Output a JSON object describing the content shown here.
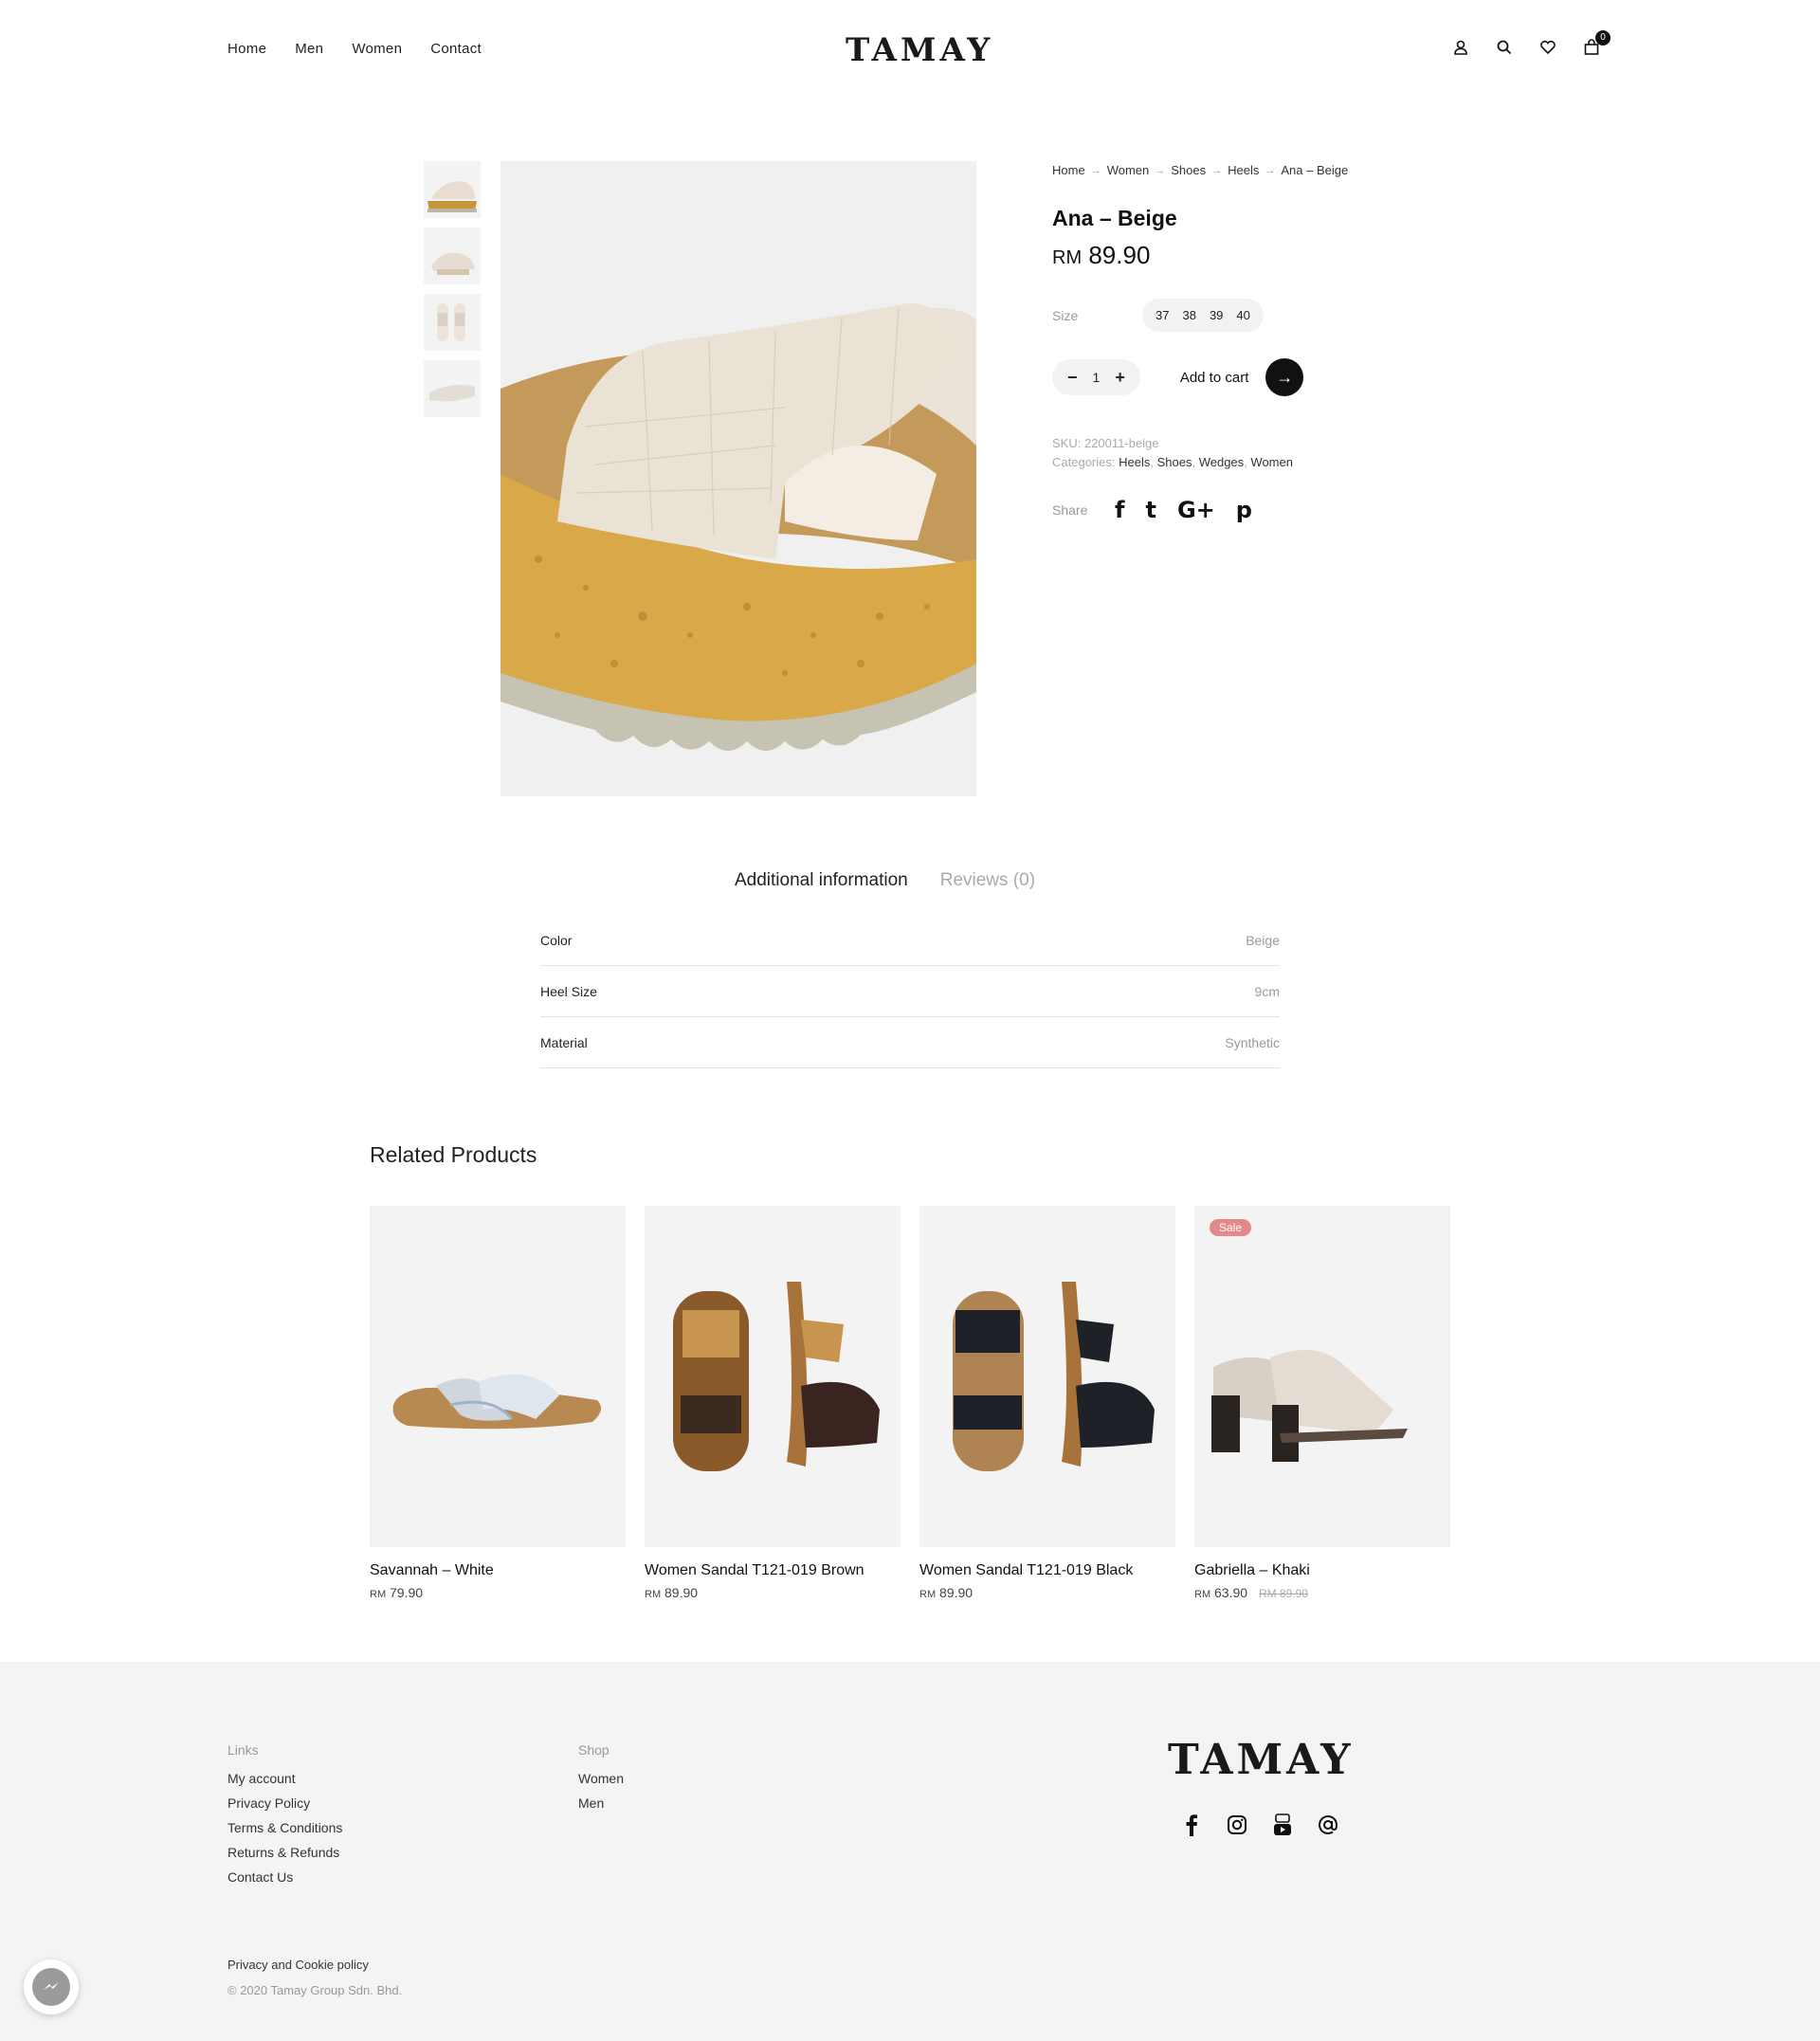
{
  "header": {
    "nav": [
      "Home",
      "Men",
      "Women",
      "Contact"
    ],
    "logo": "TAMAY",
    "cart_count": "0",
    "icons": [
      "user-icon",
      "search-icon",
      "heart-icon",
      "cart-icon"
    ]
  },
  "product": {
    "breadcrumb": [
      "Home",
      "Women",
      "Shoes",
      "Heels",
      "Ana – Beige"
    ],
    "title": "Ana – Beige",
    "currency": "RM",
    "price": "89.90",
    "size_label": "Size",
    "sizes": [
      "37",
      "38",
      "39",
      "40"
    ],
    "qty_minus": "−",
    "qty": "1",
    "qty_plus": "+",
    "add_to_cart": "Add to cart",
    "arrow": "→",
    "sku_label": "SKU:",
    "sku": "220011-beige",
    "categories_label": "Categories:",
    "categories": [
      "Heels",
      "Shoes",
      "Wedges",
      "Women"
    ],
    "share_label": "Share",
    "share_icons": [
      "f",
      "t",
      "G+",
      "p"
    ]
  },
  "tabs": {
    "additional": "Additional information",
    "reviews": "Reviews (0)"
  },
  "attributes": [
    {
      "key": "Color",
      "value": "Beige"
    },
    {
      "key": "Heel Size",
      "value": "9cm"
    },
    {
      "key": "Material",
      "value": "Synthetic"
    }
  ],
  "related": {
    "title": "Related Products",
    "items": [
      {
        "name": "Savannah – White",
        "currency": "RM",
        "price": "79.90",
        "old_price": "",
        "sale": ""
      },
      {
        "name": "Women Sandal T121-019 Brown",
        "currency": "RM",
        "price": "89.90",
        "old_price": "",
        "sale": ""
      },
      {
        "name": "Women Sandal T121-019 Black",
        "currency": "RM",
        "price": "89.90",
        "old_price": "",
        "sale": ""
      },
      {
        "name": "Gabriella – Khaki",
        "currency": "RM",
        "price": "63.90",
        "old_price": "RM 89.90",
        "sale": "Sale"
      }
    ]
  },
  "footer": {
    "links_title": "Links",
    "links": [
      "My account",
      "Privacy Policy",
      "Terms & Conditions",
      "Returns & Refunds",
      "Contact Us"
    ],
    "shop_title": "Shop",
    "shop": [
      "Women",
      "Men"
    ],
    "logo": "TAMAY",
    "social_icons": [
      "facebook-icon",
      "instagram-icon",
      "youtube-icon",
      "email-icon"
    ],
    "privacy": "Privacy and Cookie policy",
    "copyright": "© 2020 Tamay Group Sdn. Bhd."
  },
  "colors": {
    "accent": "#111111",
    "sale_badge": "#e28a8a",
    "page_bg": "#ffffff",
    "footer_bg": "#f4f4f4"
  }
}
